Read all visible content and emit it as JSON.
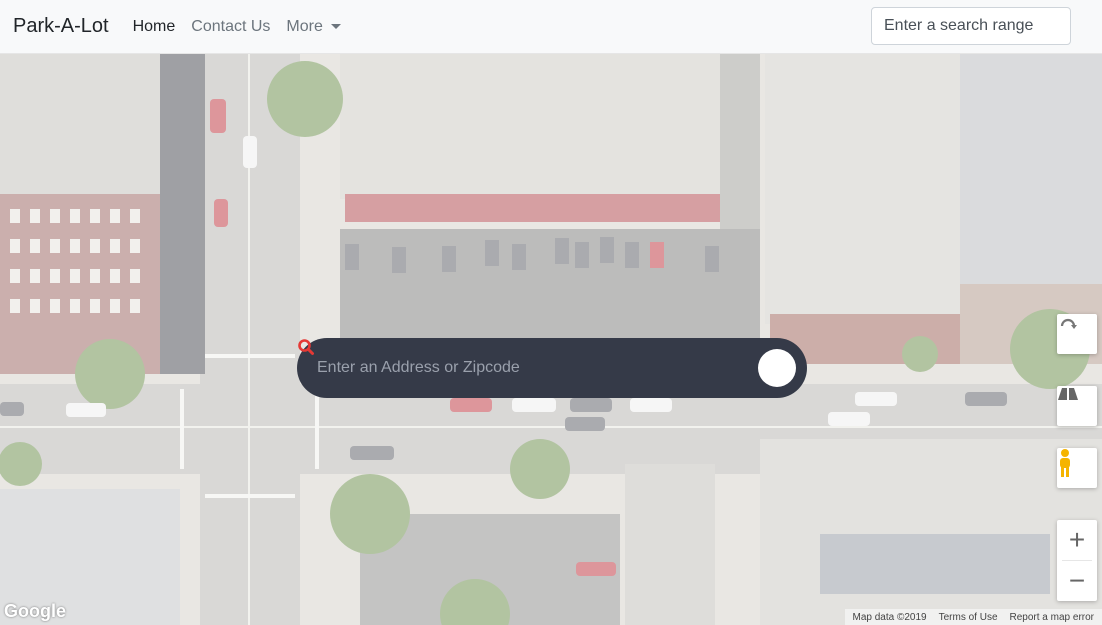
{
  "navbar": {
    "brand": "Park-A-Lot",
    "links": [
      {
        "label": "Home",
        "active": true
      },
      {
        "label": "Contact Us",
        "active": false
      },
      {
        "label": "More",
        "active": false
      }
    ],
    "search_range": {
      "placeholder": "Enter a search range",
      "value": ""
    }
  },
  "map": {
    "address_search": {
      "placeholder": "Enter an Address or Zipcode",
      "value": "",
      "button_icon": "search-icon"
    },
    "controls": {
      "rotate_icon": "rotate-icon",
      "tilt_icon": "tilt-icon",
      "street_view_icon": "pegman-icon",
      "zoom_in_label": "+",
      "zoom_out_label": "−"
    },
    "logo": "Google",
    "attribution": {
      "map_data": "Map data ©2019",
      "terms": "Terms of Use",
      "report": "Report a map error"
    }
  },
  "colors": {
    "search_bar_bg": "#353a48",
    "search_icon": "#e53935",
    "pegman": "#f5b400"
  }
}
